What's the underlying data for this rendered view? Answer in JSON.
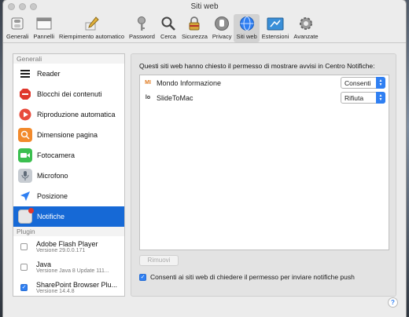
{
  "window": {
    "title": "Siti web"
  },
  "toolbar": {
    "items": [
      {
        "label": "Generali",
        "icon": "general-switch-icon"
      },
      {
        "label": "Pannelli",
        "icon": "tabs-icon"
      },
      {
        "label": "Riempimento automatico",
        "icon": "pencil-icon"
      },
      {
        "label": "Password",
        "icon": "key-icon"
      },
      {
        "label": "Cerca",
        "icon": "magnifier-icon"
      },
      {
        "label": "Sicurezza",
        "icon": "lock-icon"
      },
      {
        "label": "Privacy",
        "icon": "hand-icon"
      },
      {
        "label": "Siti web",
        "icon": "globe-icon",
        "active": true
      },
      {
        "label": "Estensioni",
        "icon": "puzzle-icon"
      },
      {
        "label": "Avanzate",
        "icon": "gear-icon"
      }
    ]
  },
  "sidebar": {
    "general_header": "Generali",
    "items": [
      {
        "label": "Reader",
        "icon": "reader-icon",
        "color": "#1a1a1a"
      },
      {
        "label": "Blocchi dei contenuti",
        "icon": "stop-icon",
        "color": "#e0372c"
      },
      {
        "label": "Riproduzione automatica",
        "icon": "play-icon",
        "color": "#e84b3c"
      },
      {
        "label": "Dimensione pagina",
        "icon": "zoom-icon",
        "color": "#f28a2c"
      },
      {
        "label": "Fotocamera",
        "icon": "camera-icon",
        "color": "#3bbf4f"
      },
      {
        "label": "Microfono",
        "icon": "microphone-icon",
        "color": "#9aa3ad"
      },
      {
        "label": "Posizione",
        "icon": "location-icon",
        "color": "#2f7ff2"
      },
      {
        "label": "Notifiche",
        "icon": "notifications-icon",
        "color": "#d8d8d8",
        "selected": true
      }
    ],
    "plugin_header": "Plugin",
    "plugins": [
      {
        "name": "Adobe Flash Player",
        "version": "Versione 29.0.0.171",
        "enabled": false
      },
      {
        "name": "Java",
        "version": "Versione Java 8 Update 111...",
        "enabled": false
      },
      {
        "name": "SharePoint Browser Plu...",
        "version": "Versione 14.4.8",
        "enabled": true
      }
    ]
  },
  "main": {
    "header": "Questi siti web hanno chiesto il permesso di mostrare avvisi in Centro Notifiche:",
    "sites": [
      {
        "name": "Mondo Informazione",
        "favicon": "MI",
        "favicon_color": "#e07a1f",
        "permission": "Consenti"
      },
      {
        "name": "SlideToMac",
        "favicon": "lo",
        "favicon_color": "#333333",
        "permission": "Rifiuta"
      }
    ],
    "remove_label": "Rimuovi",
    "allow_label": "Consenti ai siti web di chiedere il permesso per inviare notifiche push",
    "allow_checked": true
  },
  "help": {
    "label": "?"
  }
}
